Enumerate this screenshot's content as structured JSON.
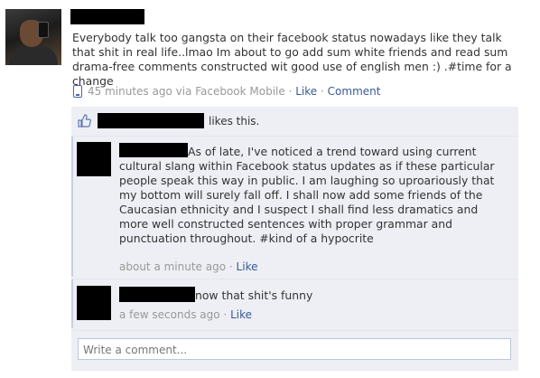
{
  "post": {
    "status_text": "Everybody talk too gangsta on their facebook status nowadays like they talk that shit in real life..lmao Im about to go add sum white friends and read sum drama-free comments constructed wit good use of english men :) .#time for a change",
    "time": "45 minutes ago via Facebook Mobile",
    "separator": "·",
    "like_label": "Like",
    "comment_label": "Comment"
  },
  "likes": {
    "text": "likes this."
  },
  "comments": [
    {
      "text": "As of late, I've noticed a trend toward using current cultural slang within Facebook status updates as if these particular people speak this way in public. I am laughing so uproariously that my bottom will surely fall off. I shall now add some friends of the Caucasian ethnicity and I suspect I shall find less dramatics and more well constructed sentences with proper grammar and punctuation throughout.  #kind of a hypocrite",
      "time": "about a minute ago",
      "like_label": "Like"
    },
    {
      "text": "now that shit's funny",
      "time": "a few seconds ago",
      "like_label": "Like"
    }
  ],
  "composer": {
    "placeholder": "Write a comment..."
  },
  "colors": {
    "link": "#3b5998",
    "thread_bg": "#edeff4",
    "meta": "#999999"
  },
  "icons": [
    "mobile-icon",
    "thumbs-up-icon"
  ]
}
